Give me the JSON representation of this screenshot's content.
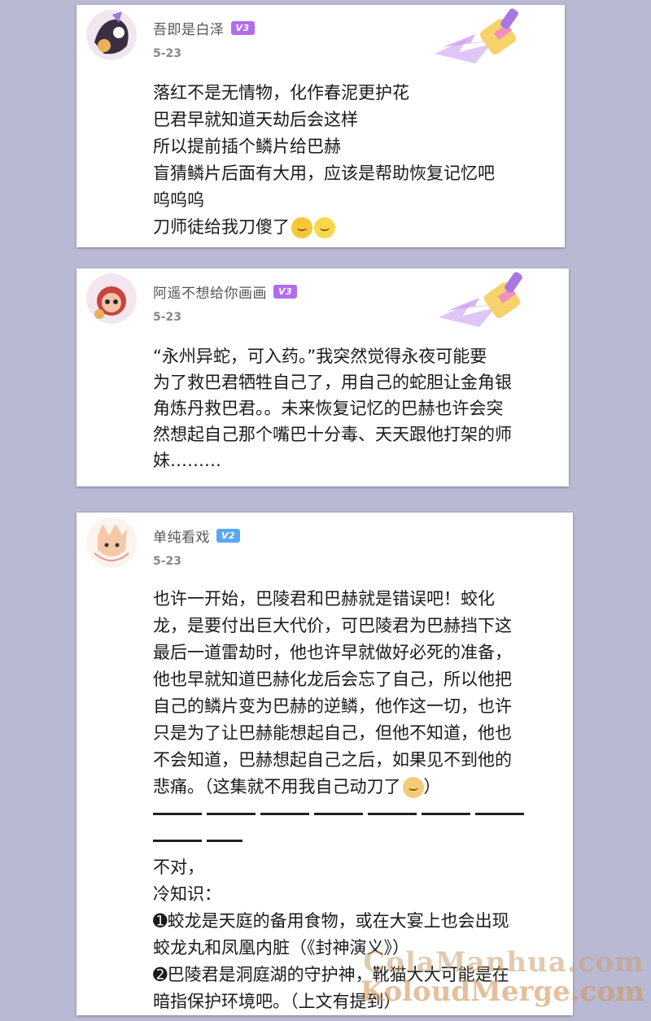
{
  "posts": [
    {
      "username": "吾即是白泽",
      "level": "V3",
      "date": "5-23",
      "lines": [
        "落红不是无情物，化作春泥更护花",
        "巴君早就知道天劫后会这样",
        "所以提前插个鳞片给巴赫",
        "盲猜鳞片后面有大用，应该是帮助恢复记忆吧",
        "呜呜呜",
        "刀师徒给我刀傻了"
      ]
    },
    {
      "username": "阿遥不想给你画画",
      "level": "V3",
      "date": "5-23",
      "lines": [
        "“永州异蛇，可入药。”我突然觉得永夜可能要",
        "为了救巴君牺牲自己了，用自己的蛇胆让金角银",
        "角炼丹救巴君。。未来恢复记忆的巴赫也许会突",
        "然想起自己那个嘴巴十分毒、天天跟他打架的师",
        "妹………"
      ]
    },
    {
      "username": "单纯看戏",
      "level": "V2",
      "date": "5-23",
      "lines": [
        "也许一开始，巴陵君和巴赫就是错误吧！蛟化",
        "龙，是要付出巨大代价，可巴陵君为巴赫挡下这",
        "最后一道雷劫时，他也许早就做好必死的准备，",
        "他也早就知道巴赫化龙后会忘了自己，所以他把",
        "自己的鳞片变为巴赫的逆鳞，他作这一切，也许",
        "只是为了让巴赫能想起自己，但他不知道，他也",
        "不会知道，巴赫想起自己之后，如果见不到他的",
        "悲痛。（这集就不用我自己动刀了",
        "）",
        "不对，",
        "冷知识：",
        "➊蛟龙是天庭的备用食物，或在大宴上也会出现",
        "蛟龙丸和凤凰内脏（《封神演义》）",
        "➋巴陵君是洞庭湖的守护神，靴猫大大可能是在",
        "暗指保护环境吧。（上文有提到）"
      ]
    }
  ],
  "watermark": {
    "line1": "ColaManhua.com",
    "line2": "KoloudMerge.com"
  },
  "colors": {
    "background": "#b9b9d3",
    "v3_badge": "#b36cf0",
    "v2_badge": "#5aa8f0"
  }
}
